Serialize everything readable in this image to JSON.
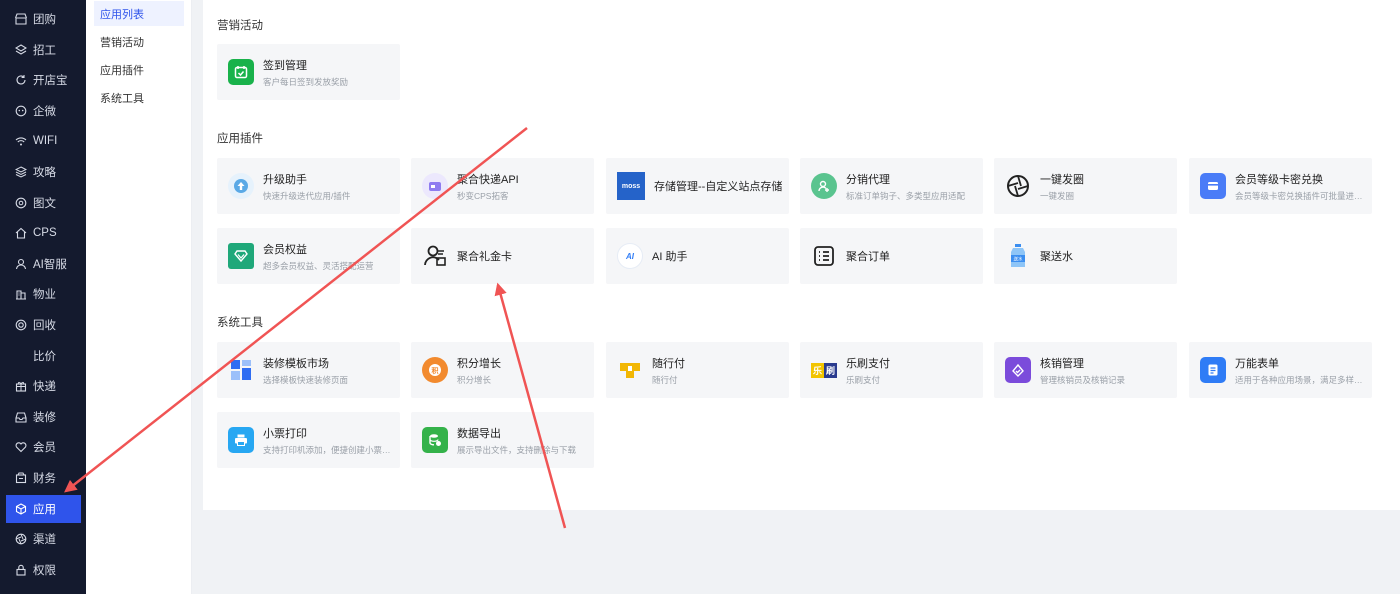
{
  "sidebar": {
    "items": [
      {
        "label": "团购",
        "icon": "shop-icon"
      },
      {
        "label": "招工",
        "icon": "layers-icon"
      },
      {
        "label": "开店宝",
        "icon": "refresh-icon"
      },
      {
        "label": "企微",
        "icon": "wechat-icon"
      },
      {
        "label": "WIFI",
        "icon": "wifi-icon"
      },
      {
        "label": "攻略",
        "icon": "stack-icon"
      },
      {
        "label": "图文",
        "icon": "image-text-icon"
      },
      {
        "label": "CPS",
        "icon": "home-icon"
      },
      {
        "label": "AI智服",
        "icon": "user-icon"
      },
      {
        "label": "物业",
        "icon": "building-icon"
      },
      {
        "label": "回收",
        "icon": "recycle-icon"
      },
      {
        "label": "比价",
        "icon": ""
      },
      {
        "label": "快递",
        "icon": "gift-icon"
      },
      {
        "label": "装修",
        "icon": "inbox-icon"
      },
      {
        "label": "会员",
        "icon": "heart-icon"
      },
      {
        "label": "财务",
        "icon": "wallet-icon"
      },
      {
        "label": "应用",
        "icon": "cube-icon",
        "active": true
      },
      {
        "label": "渠道",
        "icon": "aperture-icon"
      },
      {
        "label": "权限",
        "icon": "lock-icon"
      }
    ]
  },
  "submenu": {
    "items": [
      {
        "label": "应用列表",
        "active": true
      },
      {
        "label": "营销活动"
      },
      {
        "label": "应用插件"
      },
      {
        "label": "系统工具"
      }
    ]
  },
  "sections": {
    "marketing": {
      "title": "营销活动",
      "cards": [
        {
          "name": "签到管理",
          "desc": "客户每日签到发放奖励",
          "icon": "calendar-check-icon",
          "color": "#19b24b"
        }
      ]
    },
    "plugins": {
      "title": "应用插件",
      "cards": [
        {
          "name": "升级助手",
          "desc": "快速升级迭代应用/插件",
          "icon": "upgrade-icon",
          "color": "#5aa9e6"
        },
        {
          "name": "聚合快递API",
          "desc": "秒变CPS拓客",
          "icon": "express-api-icon",
          "color": "#8f7cf0"
        },
        {
          "name": "存储管理--自定义站点存储",
          "desc": "",
          "icon": "moss-logo-icon",
          "color": "#2563c9",
          "logo_text": "moss"
        },
        {
          "name": "分销代理",
          "desc": "标准订单钩子、多类型应用适配",
          "icon": "distribution-icon",
          "color": "#5ac48f"
        },
        {
          "name": "一键发圈",
          "desc": "一键发圈",
          "icon": "aperture-icon",
          "color": "#222222"
        },
        {
          "name": "会员等级卡密兑换",
          "desc": "会员等级卡密兑换插件可批量进行兑换",
          "icon": "card-exchange-icon",
          "color": "#4a7cf7"
        },
        {
          "name": "会员权益",
          "desc": "超多会员权益、灵活搭配运营",
          "icon": "diamond-icon",
          "color": "#1fa87a"
        },
        {
          "name": "聚合礼金卡",
          "desc": "",
          "icon": "gift-card-user-icon",
          "color": "#222222"
        },
        {
          "name": "AI 助手",
          "desc": "",
          "icon": "ai-assistant-icon",
          "color": "#2f7cf6",
          "logo_text": "AI"
        },
        {
          "name": "聚合订单",
          "desc": "",
          "icon": "order-list-icon",
          "color": "#222222"
        },
        {
          "name": "聚送水",
          "desc": "",
          "icon": "water-bottle-icon",
          "color": "#3b8ef0",
          "logo_text": "送水"
        }
      ]
    },
    "tools": {
      "title": "系统工具",
      "cards": [
        {
          "name": "装修模板市场",
          "desc": "选择模板快速装修页面",
          "icon": "template-grid-icon",
          "color": "#2f6df2"
        },
        {
          "name": "积分增长",
          "desc": "积分增长",
          "icon": "points-icon",
          "color": "#f28a2e"
        },
        {
          "name": "随行付",
          "desc": "随行付",
          "icon": "pay-logo-icon",
          "color": "#f2b705"
        },
        {
          "name": "乐刷支付",
          "desc": "乐刷支付",
          "icon": "leshua-logo-icon",
          "color": "#f2c400",
          "logo_text": "乐 刷"
        },
        {
          "name": "核销管理",
          "desc": "管理核销员及核销记录",
          "icon": "verify-icon",
          "color": "#7b4bdb"
        },
        {
          "name": "万能表单",
          "desc": "适用于各种应用场景，满足多样化需求",
          "icon": "form-icon",
          "color": "#2f7cf6"
        },
        {
          "name": "小票打印",
          "desc": "支持打印机添加，便捷创建小票模板",
          "icon": "printer-icon",
          "color": "#27a7f2"
        },
        {
          "name": "数据导出",
          "desc": "展示导出文件，支持删除与下载",
          "icon": "database-export-icon",
          "color": "#34b24a"
        }
      ]
    }
  },
  "colors": {
    "sidebar_bg": "#141a2e",
    "accent": "#2f54eb",
    "annotation_arrow": "#f05454"
  }
}
